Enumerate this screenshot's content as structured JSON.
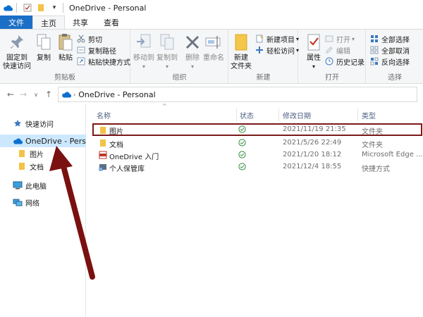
{
  "window": {
    "title": "OneDrive - Personal"
  },
  "tabs": [
    "文件",
    "主页",
    "共享",
    "查看"
  ],
  "ribbon": {
    "clipboard": {
      "label": "剪贴板",
      "pin_label": "固定到\n快速访问",
      "copy_label": "复制",
      "paste_label": "粘贴",
      "cut_label": "剪切",
      "copy_path_label": "复制路径",
      "paste_shortcut_label": "粘贴快捷方式"
    },
    "organize": {
      "label": "组织",
      "move_to_label": "移动到",
      "copy_to_label": "复制到",
      "delete_label": "删除",
      "rename_label": "重命名"
    },
    "new": {
      "label": "新建",
      "new_folder_label": "新建\n文件夹",
      "new_item_label": "新建项目",
      "easy_access_label": "轻松访问"
    },
    "open": {
      "label": "打开",
      "properties_label": "属性",
      "open_label": "打开",
      "edit_label": "编辑",
      "history_label": "历史记录"
    },
    "select": {
      "label": "选择",
      "select_all_label": "全部选择",
      "select_none_label": "全部取消",
      "invert_label": "反向选择"
    }
  },
  "address": {
    "path": "OneDrive - Personal"
  },
  "nav": {
    "items": [
      {
        "label": "快速访问",
        "icon": "star-icon"
      },
      {
        "label": "OneDrive - Personal",
        "icon": "cloud-icon"
      },
      {
        "label": "图片",
        "icon": "folder-icon"
      },
      {
        "label": "文档",
        "icon": "folder-icon"
      },
      {
        "label": "此电脑",
        "icon": "pc-icon"
      },
      {
        "label": "网络",
        "icon": "network-icon"
      }
    ]
  },
  "list": {
    "columns": [
      "名称",
      "状态",
      "修改日期",
      "类型"
    ],
    "rows": [
      {
        "name": "图片",
        "date": "2021/11/19 21:35",
        "type": "文件夹",
        "icon": "folder-icon"
      },
      {
        "name": "文档",
        "date": "2021/5/26 22:49",
        "type": "文件夹",
        "icon": "folder-icon"
      },
      {
        "name": "OneDrive 入门",
        "date": "2021/1/20 18:12",
        "type": "Microsoft Edge ...",
        "icon": "pdf-icon"
      },
      {
        "name": "个人保管库",
        "date": "2021/12/4 18:55",
        "type": "快捷方式",
        "icon": "shortcut-icon"
      }
    ]
  },
  "colors": {
    "accent": "#1c6fc6",
    "selection": "#cce8ff",
    "highlight_box": "#7a1a1a",
    "arrow": "#7a1010",
    "synced": "#2e8b3a"
  }
}
